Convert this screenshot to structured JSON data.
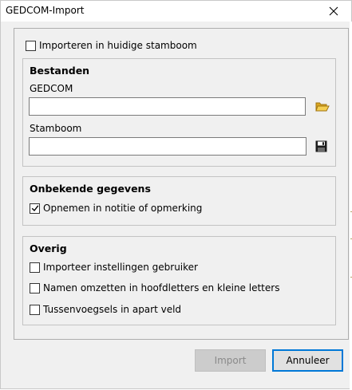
{
  "window": {
    "title": "GEDCOM-Import",
    "close_glyph": "close-icon"
  },
  "import_current": {
    "label": "Importeren in huidige stamboom",
    "checked": false
  },
  "files_group": {
    "title": "Bestanden",
    "gedcom_label": "GEDCOM",
    "gedcom_value": "",
    "stamboom_label": "Stamboom",
    "stamboom_value": "",
    "browse_icon": "folder-open-icon",
    "save_icon": "floppy-disk-icon"
  },
  "unknown_group": {
    "title": "Onbekende gegevens",
    "include_note_label": "Opnemen in notitie of opmerking",
    "include_note_checked": true
  },
  "other_group": {
    "title": "Overig",
    "options": [
      {
        "label": "Importeer instellingen gebruiker",
        "checked": false
      },
      {
        "label": "Namen omzetten in hoofdletters en kleine letters",
        "checked": false
      },
      {
        "label": "Tussenvoegsels in apart veld",
        "checked": false
      }
    ]
  },
  "buttons": {
    "import_label": "Import",
    "cancel_label": "Annuleer"
  },
  "colors": {
    "accent": "#0078d7",
    "folder": "#e8b83a",
    "dialog_bg": "#f0f0f0"
  }
}
